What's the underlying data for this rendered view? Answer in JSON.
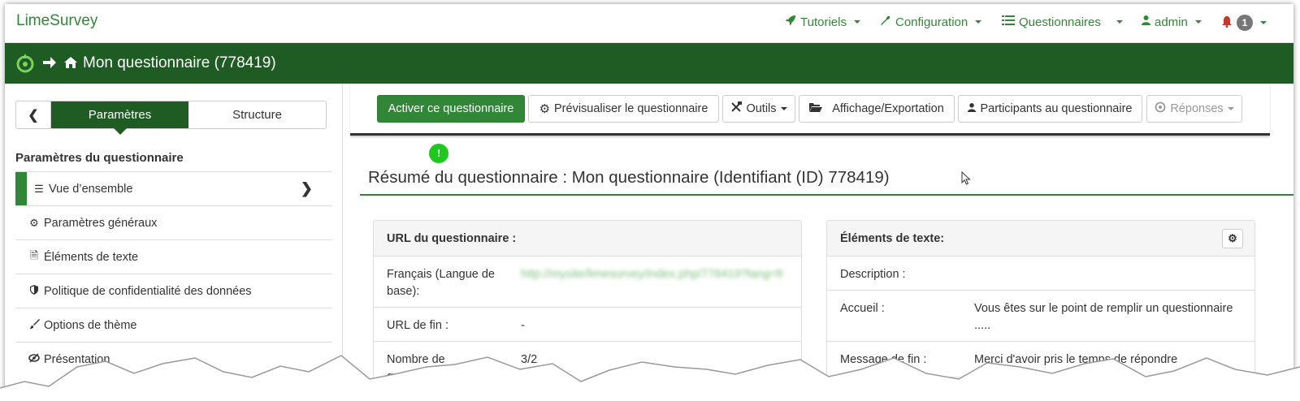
{
  "brand": "LimeSurvey",
  "nav": {
    "tutorials": "Tutoriels",
    "configuration": "Configuration",
    "surveys": "Questionnaires",
    "user": "admin",
    "notifications_count": "1"
  },
  "surveybar": {
    "title": "Mon questionnaire (778419)"
  },
  "sidebar": {
    "tabs": {
      "settings": "Paramètres",
      "structure": "Structure"
    },
    "heading": "Paramètres du questionnaire",
    "items": [
      {
        "label": "Vue d’ensemble",
        "icon": "list-icon"
      },
      {
        "label": "Paramètres généraux",
        "icon": "cogs-icon"
      },
      {
        "label": "Éléments de texte",
        "icon": "document-icon"
      },
      {
        "label": "Politique de confidentialité des données",
        "icon": "shield-icon"
      },
      {
        "label": "Options de thème",
        "icon": "brush-icon"
      },
      {
        "label": "Présentation",
        "icon": "eye-slash-icon"
      }
    ]
  },
  "toolbar": {
    "activate": "Activer ce questionnaire",
    "preview": "Prévisualiser le questionnaire",
    "tools": "Outils",
    "display_export": "Affichage/Exportation",
    "participants": "Participants au questionnaire",
    "responses": "Réponses"
  },
  "tour_dot": "!",
  "page_title": "Résumé du questionnaire : Mon questionnaire (Identifiant (ID) 778419)",
  "url_panel": {
    "heading": "URL du questionnaire :",
    "rows": [
      {
        "key": "Français (Langue de base):",
        "value": "http://mysite/limesurvey/index.php/778419?lang=fr"
      },
      {
        "key": "URL de fin :",
        "value": "-"
      },
      {
        "key": "Nombre de question(s)/groupe(s) :",
        "value": "3/2"
      }
    ]
  },
  "text_panel": {
    "heading": "Éléments de texte:",
    "rows": [
      {
        "key": "Description :",
        "value": ""
      },
      {
        "key": "Accueil :",
        "value": "Vous êtes sur le point de remplir un questionnaire ....."
      },
      {
        "key": "Message de fin :",
        "value": "Merci d'avoir pris le temps de répondre"
      }
    ]
  },
  "colors": {
    "brand_green": "#328637",
    "dark_green": "#1e5c24",
    "tour_dot": "#1ec81e"
  }
}
